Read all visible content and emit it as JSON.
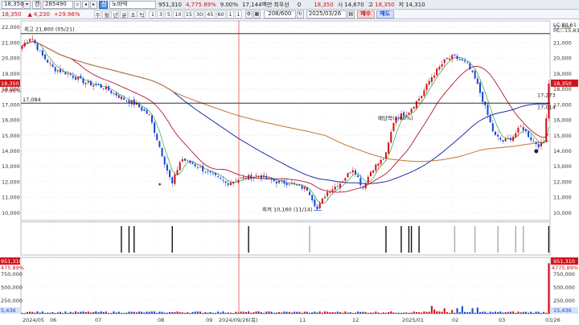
{
  "toolbar": {
    "prev_price": "18,350",
    "stock_code": "285490",
    "stock_name": "노바텍",
    "change": "4,230",
    "change_pct": "+29.96%",
    "volume": "951,310",
    "volume_change_pct": "4,775.89%",
    "turnover_pct": "9.00%",
    "trade_amount": "17,144백만",
    "market_label": "최우선",
    "zero_val": "0",
    "cur_price": "18,350",
    "open_label": "시",
    "open_val": "14,670",
    "high_label": "고",
    "high_val": "18,350",
    "low_label": "저",
    "low_val": "14,310",
    "period_tabs": [
      "주",
      "월",
      "년",
      "분",
      "초",
      "틱"
    ],
    "intervals": [
      "1",
      "3",
      "5",
      "10",
      "15",
      "30",
      "45",
      "60",
      "1",
      "1"
    ],
    "count_display": "208/600",
    "date": "2025/03/26",
    "buy_label": "매수",
    "sell_label": "매도",
    "tag_label": "신",
    "mini_label": "캔"
  },
  "info_bar": {
    "last": "18,350",
    "change": "4,230",
    "change_pct": "+29.96%"
  },
  "chart_data": {
    "type": "candlestick",
    "price_axis": {
      "ticks": [
        "22,000",
        "21,000",
        "20,000",
        "19,000",
        "18,000",
        "17,000",
        "16,000",
        "15,000",
        "14,000",
        "13,000",
        "12,000",
        "11,000",
        "10,000"
      ],
      "range": [
        9500,
        22400
      ]
    },
    "x_axis": {
      "labels": [
        "2024/05",
        "06",
        "07",
        "08",
        "09",
        "2024/09/26(목)",
        "11",
        "12",
        "2025/01",
        "02",
        "03",
        "03/26"
      ]
    },
    "annotations": {
      "high": "최고 21,800 (05/21)",
      "low": "최저 10,160 (11/14)",
      "dividend": "배당락(0.00%)",
      "hline_price": "17,084",
      "current_tag": "18,350",
      "current_pct": "29.96%",
      "ma_tag1": "17,273",
      "ma_tag2": "17,014",
      "right_top1": "LC:80.61",
      "right_top2": "HC:-15.83"
    },
    "volume_panel": {
      "ticks": [
        "750,000",
        "500,000",
        "250,000"
      ],
      "left_top": "951,310",
      "left_top_pct": "475.89%",
      "current": "951,310",
      "current_pct": "4775.89%",
      "last_small": "15,436",
      "left_small": "5,436"
    },
    "colors": {
      "up": "#d2121b",
      "down": "#1a47d4",
      "ma5": "#2e9e3e",
      "ma20": "#b5162d",
      "ma60": "#1f2fa8",
      "ma120": "#c0772e"
    }
  }
}
